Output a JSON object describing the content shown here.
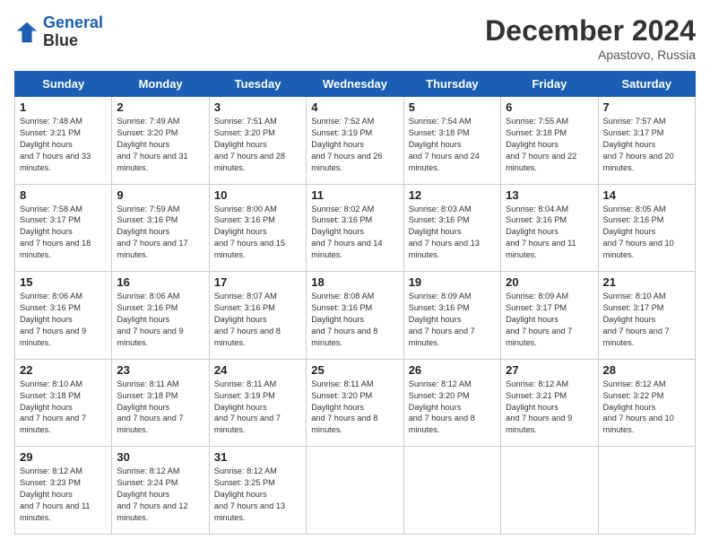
{
  "header": {
    "logo_line1": "General",
    "logo_line2": "Blue",
    "title": "December 2024",
    "location": "Apastovo, Russia"
  },
  "days_of_week": [
    "Sunday",
    "Monday",
    "Tuesday",
    "Wednesday",
    "Thursday",
    "Friday",
    "Saturday"
  ],
  "weeks": [
    [
      {
        "day": "1",
        "sunrise": "7:48 AM",
        "sunset": "3:21 PM",
        "daylight": "7 hours and 33 minutes."
      },
      {
        "day": "2",
        "sunrise": "7:49 AM",
        "sunset": "3:20 PM",
        "daylight": "7 hours and 31 minutes."
      },
      {
        "day": "3",
        "sunrise": "7:51 AM",
        "sunset": "3:20 PM",
        "daylight": "7 hours and 28 minutes."
      },
      {
        "day": "4",
        "sunrise": "7:52 AM",
        "sunset": "3:19 PM",
        "daylight": "7 hours and 26 minutes."
      },
      {
        "day": "5",
        "sunrise": "7:54 AM",
        "sunset": "3:18 PM",
        "daylight": "7 hours and 24 minutes."
      },
      {
        "day": "6",
        "sunrise": "7:55 AM",
        "sunset": "3:18 PM",
        "daylight": "7 hours and 22 minutes."
      },
      {
        "day": "7",
        "sunrise": "7:57 AM",
        "sunset": "3:17 PM",
        "daylight": "7 hours and 20 minutes."
      }
    ],
    [
      {
        "day": "8",
        "sunrise": "7:58 AM",
        "sunset": "3:17 PM",
        "daylight": "7 hours and 18 minutes."
      },
      {
        "day": "9",
        "sunrise": "7:59 AM",
        "sunset": "3:16 PM",
        "daylight": "7 hours and 17 minutes."
      },
      {
        "day": "10",
        "sunrise": "8:00 AM",
        "sunset": "3:16 PM",
        "daylight": "7 hours and 15 minutes."
      },
      {
        "day": "11",
        "sunrise": "8:02 AM",
        "sunset": "3:16 PM",
        "daylight": "7 hours and 14 minutes."
      },
      {
        "day": "12",
        "sunrise": "8:03 AM",
        "sunset": "3:16 PM",
        "daylight": "7 hours and 13 minutes."
      },
      {
        "day": "13",
        "sunrise": "8:04 AM",
        "sunset": "3:16 PM",
        "daylight": "7 hours and 11 minutes."
      },
      {
        "day": "14",
        "sunrise": "8:05 AM",
        "sunset": "3:16 PM",
        "daylight": "7 hours and 10 minutes."
      }
    ],
    [
      {
        "day": "15",
        "sunrise": "8:06 AM",
        "sunset": "3:16 PM",
        "daylight": "7 hours and 9 minutes."
      },
      {
        "day": "16",
        "sunrise": "8:06 AM",
        "sunset": "3:16 PM",
        "daylight": "7 hours and 9 minutes."
      },
      {
        "day": "17",
        "sunrise": "8:07 AM",
        "sunset": "3:16 PM",
        "daylight": "7 hours and 8 minutes."
      },
      {
        "day": "18",
        "sunrise": "8:08 AM",
        "sunset": "3:16 PM",
        "daylight": "7 hours and 8 minutes."
      },
      {
        "day": "19",
        "sunrise": "8:09 AM",
        "sunset": "3:16 PM",
        "daylight": "7 hours and 7 minutes."
      },
      {
        "day": "20",
        "sunrise": "8:09 AM",
        "sunset": "3:17 PM",
        "daylight": "7 hours and 7 minutes."
      },
      {
        "day": "21",
        "sunrise": "8:10 AM",
        "sunset": "3:17 PM",
        "daylight": "7 hours and 7 minutes."
      }
    ],
    [
      {
        "day": "22",
        "sunrise": "8:10 AM",
        "sunset": "3:18 PM",
        "daylight": "7 hours and 7 minutes."
      },
      {
        "day": "23",
        "sunrise": "8:11 AM",
        "sunset": "3:18 PM",
        "daylight": "7 hours and 7 minutes."
      },
      {
        "day": "24",
        "sunrise": "8:11 AM",
        "sunset": "3:19 PM",
        "daylight": "7 hours and 7 minutes."
      },
      {
        "day": "25",
        "sunrise": "8:11 AM",
        "sunset": "3:20 PM",
        "daylight": "7 hours and 8 minutes."
      },
      {
        "day": "26",
        "sunrise": "8:12 AM",
        "sunset": "3:20 PM",
        "daylight": "7 hours and 8 minutes."
      },
      {
        "day": "27",
        "sunrise": "8:12 AM",
        "sunset": "3:21 PM",
        "daylight": "7 hours and 9 minutes."
      },
      {
        "day": "28",
        "sunrise": "8:12 AM",
        "sunset": "3:22 PM",
        "daylight": "7 hours and 10 minutes."
      }
    ],
    [
      {
        "day": "29",
        "sunrise": "8:12 AM",
        "sunset": "3:23 PM",
        "daylight": "7 hours and 11 minutes."
      },
      {
        "day": "30",
        "sunrise": "8:12 AM",
        "sunset": "3:24 PM",
        "daylight": "7 hours and 12 minutes."
      },
      {
        "day": "31",
        "sunrise": "8:12 AM",
        "sunset": "3:25 PM",
        "daylight": "7 hours and 13 minutes."
      },
      null,
      null,
      null,
      null
    ]
  ]
}
